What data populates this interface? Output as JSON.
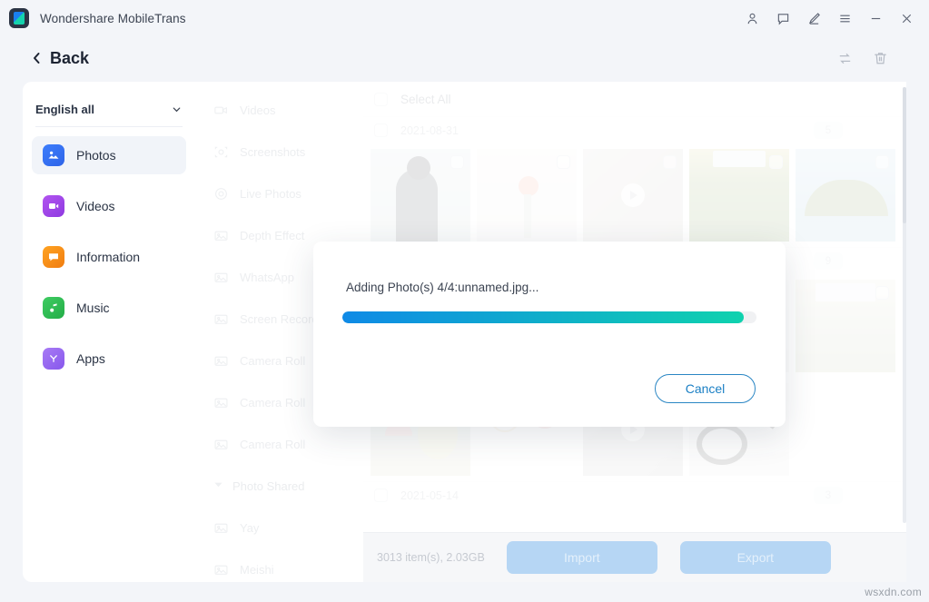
{
  "window": {
    "app_title": "Wondershare MobileTrans",
    "logo_icon": "mobiletrans-logo-icon",
    "controls": [
      {
        "name": "account-icon",
        "glyph": "person"
      },
      {
        "name": "feedback-icon",
        "glyph": "chat-bubble"
      },
      {
        "name": "edit-icon",
        "glyph": "pen"
      },
      {
        "name": "menu-icon",
        "glyph": "hamburger"
      },
      {
        "name": "minimize-icon",
        "glyph": "minus"
      },
      {
        "name": "close-icon",
        "glyph": "cross"
      }
    ]
  },
  "backbar": {
    "back_label": "Back",
    "tools": [
      {
        "name": "refresh-icon",
        "glyph": "sync"
      },
      {
        "name": "delete-icon",
        "glyph": "trash"
      }
    ]
  },
  "sidebar": {
    "language_select": {
      "value": "English all",
      "chevron": "chevron-down-icon"
    },
    "items": [
      {
        "label": "Photos",
        "icon": "photos-icon",
        "active": true
      },
      {
        "label": "Videos",
        "icon": "videos-icon",
        "active": false
      },
      {
        "label": "Information",
        "icon": "information-icon",
        "active": false
      },
      {
        "label": "Music",
        "icon": "music-icon",
        "active": false
      },
      {
        "label": "Apps",
        "icon": "apps-icon",
        "active": false
      }
    ]
  },
  "categories": [
    {
      "label": "Videos",
      "icon": "video-camera-icon"
    },
    {
      "label": "Screenshots",
      "icon": "screenshot-icon"
    },
    {
      "label": "Live Photos",
      "icon": "live-photo-icon"
    },
    {
      "label": "Depth Effect",
      "icon": "picture-icon"
    },
    {
      "label": "WhatsApp",
      "icon": "picture-icon"
    },
    {
      "label": "Screen Recorder",
      "icon": "picture-icon"
    },
    {
      "label": "Camera Roll",
      "icon": "picture-icon"
    },
    {
      "label": "Camera Roll",
      "icon": "picture-icon"
    },
    {
      "label": "Camera Roll",
      "icon": "picture-icon"
    },
    {
      "label": "Photo Shared",
      "icon": "caret-down-icon",
      "is_group": true
    },
    {
      "label": "Yay",
      "icon": "picture-icon"
    },
    {
      "label": "Meishi",
      "icon": "picture-icon"
    }
  ],
  "main": {
    "select_all_label": "Select All",
    "groups": [
      {
        "date": "2021-08-31",
        "count": "5",
        "photos": [
          {
            "art": "art-person",
            "type": "photo"
          },
          {
            "art": "art-flower",
            "type": "photo"
          },
          {
            "art": "art-video1",
            "type": "video"
          },
          {
            "art": "art-green",
            "type": "photo"
          },
          {
            "art": "art-palm",
            "type": "photo"
          }
        ]
      },
      {
        "date": "",
        "count": "9",
        "photos": [
          {
            "art": "art-mush",
            "type": "photo"
          },
          {
            "art": "art-chart",
            "type": "photo"
          },
          {
            "art": "art-video2",
            "type": "video"
          },
          {
            "art": "art-cable",
            "type": "photo"
          },
          {
            "art": "art-house",
            "type": "photo"
          }
        ]
      },
      {
        "date": "2021-05-14",
        "count": "3",
        "photos": []
      }
    ]
  },
  "bottom": {
    "item_count": "3013 item(s), 2.03GB",
    "import_label": "Import",
    "export_label": "Export"
  },
  "dialog": {
    "message": "Adding Photo(s) 4/4:unnamed.jpg...",
    "progress_percent": 97,
    "cancel_label": "Cancel",
    "progress_start_color": "#0f8ae6",
    "progress_end_color": "#0fd2ae"
  },
  "watermark": "wsxdn.com"
}
